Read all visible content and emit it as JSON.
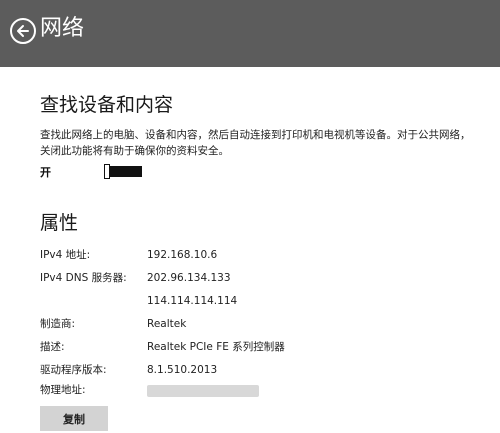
{
  "header": {
    "title": "网络"
  },
  "discovery": {
    "title": "查找设备和内容",
    "description": "查找此网络上的电脑、设备和内容，然后自动连接到打印机和电视机等设备。对于公共网络，关闭此功能将有助于确保你的资料安全。",
    "toggle_label": "开",
    "toggle_on": true
  },
  "properties": {
    "title": "属性",
    "rows": [
      {
        "key": "IPv4 地址:",
        "value": "192.168.10.6"
      },
      {
        "key": "IPv4 DNS 服务器:",
        "value": "202.96.134.133"
      },
      {
        "key": "",
        "value": "114.114.114.114"
      },
      {
        "key": "制造商:",
        "value": "Realtek"
      },
      {
        "key": "描述:",
        "value": "Realtek PCIe FE 系列控制器"
      },
      {
        "key": "驱动程序版本:",
        "value": "8.1.510.2013"
      },
      {
        "key": "物理地址:",
        "value": ""
      }
    ]
  },
  "actions": {
    "copy_label": "复制"
  },
  "colors": {
    "header_bg": "#5c5c5c",
    "toggle_fill": "#111111",
    "button_bg": "#d3d3d3"
  }
}
